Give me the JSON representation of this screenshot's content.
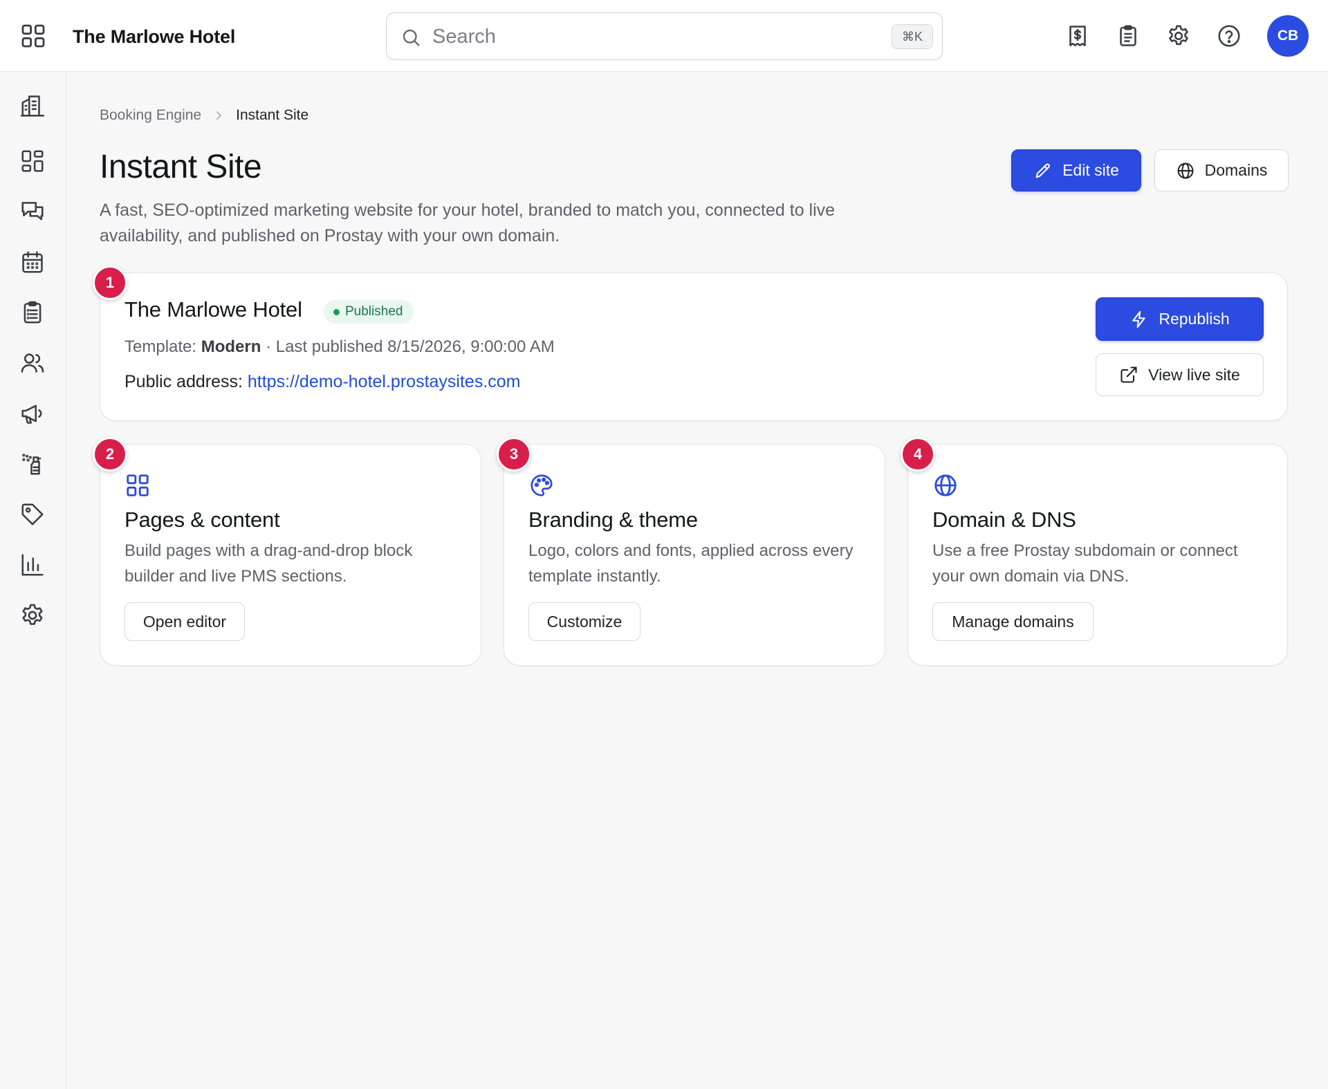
{
  "header": {
    "app_title": "The Marlowe Hotel",
    "search_placeholder": "Search",
    "search_shortcut": "⌘K",
    "icons": [
      "apps-grid-icon",
      "receipt-icon",
      "clipboard-icon",
      "gear-icon",
      "help-icon"
    ],
    "avatar_initials": "CB"
  },
  "sidebar": {
    "items": [
      {
        "icon": "hotel-building-icon"
      },
      {
        "icon": "dashboard-icon"
      },
      {
        "icon": "messages-icon"
      },
      {
        "icon": "calendar-icon"
      },
      {
        "icon": "clipboard-list-icon"
      },
      {
        "icon": "guests-icon"
      },
      {
        "icon": "megaphone-icon"
      },
      {
        "icon": "housekeeping-spray-icon"
      },
      {
        "icon": "tag-icon"
      },
      {
        "icon": "bar-chart-icon"
      },
      {
        "icon": "settings-icon"
      }
    ]
  },
  "breadcrumb": {
    "root": "Booking Engine",
    "current": "Instant Site"
  },
  "page": {
    "title": "Instant Site",
    "description": "A fast, SEO-optimized marketing website for your hotel, branded to match you, connected to live availability, and published on Prostay with your own domain.",
    "edit_site_label": "Edit site",
    "domains_label": "Domains"
  },
  "site_card": {
    "step": "1",
    "name": "The Marlowe Hotel",
    "status": "Published",
    "template_prefix": "Template: ",
    "template_name": "Modern",
    "published_text": " · Last published 8/15/2026, 9:00:00 AM",
    "address_prefix": "Public address: ",
    "address_url": "https://demo-hotel.prostaysites.com",
    "republish_label": "Republish",
    "view_live_label": "View live site"
  },
  "feature_cards": [
    {
      "step": "2",
      "icon": "grid-icon",
      "title": "Pages & content",
      "description": "Build pages with a drag-and-drop block builder and live PMS sections.",
      "button": "Open editor"
    },
    {
      "step": "3",
      "icon": "palette-icon",
      "title": "Branding & theme",
      "description": "Logo, colors and fonts, applied across every template instantly.",
      "button": "Customize"
    },
    {
      "step": "4",
      "icon": "globe-icon",
      "title": "Domain & DNS",
      "description": "Use a free Prostay subdomain or connect your own domain via DNS.",
      "button": "Manage domains"
    }
  ],
  "colors": {
    "primary": "#2c4be0",
    "step_badge": "#d81e4b",
    "published_text": "#18794e",
    "link": "#1f4fd1"
  }
}
